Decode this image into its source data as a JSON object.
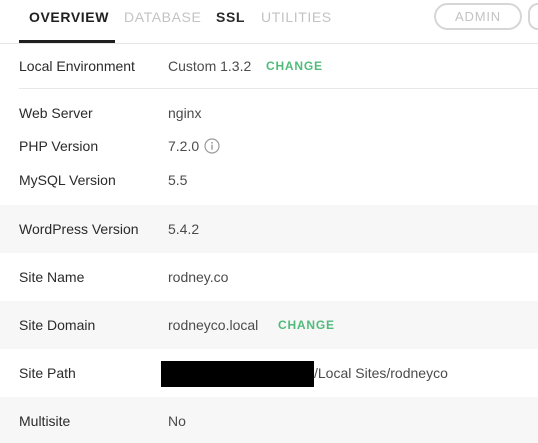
{
  "tabs": [
    {
      "label": "OVERVIEW"
    },
    {
      "label": "DATABASE"
    },
    {
      "label": "SSL"
    },
    {
      "label": "UTILITIES"
    }
  ],
  "admin_label": "ADMIN",
  "environment": {
    "label": "Local Environment",
    "value": "Custom 1.3.2",
    "action": "CHANGE"
  },
  "details": [
    {
      "label": "Web Server",
      "value": "nginx"
    },
    {
      "label": "PHP Version",
      "value": "7.2.0"
    },
    {
      "label": "MySQL Version",
      "value": "5.5"
    },
    {
      "label": "WordPress Version",
      "value": "5.4.2"
    },
    {
      "label": "Site Name",
      "value": "rodney.co"
    },
    {
      "label": "Site Domain",
      "value": "rodneyco.local",
      "action": "CHANGE"
    },
    {
      "label": "Site Path",
      "value": "/Local Sites/rodneyco"
    },
    {
      "label": "Multisite",
      "value": "No"
    }
  ],
  "icons": {
    "info": "info-icon"
  },
  "colors": {
    "accent": "#51bb7b",
    "shaded_row": "#f7f7f7",
    "inactive_tab": "#c3c3c3",
    "redaction": "#000000"
  }
}
